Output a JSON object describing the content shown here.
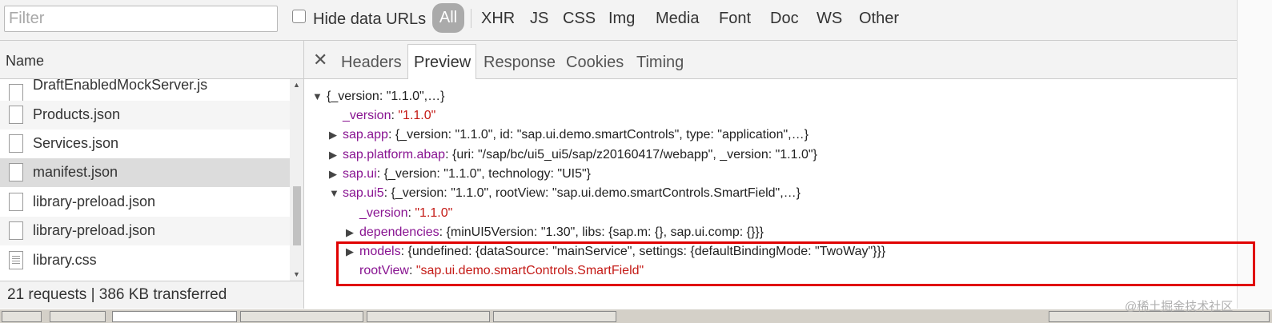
{
  "toolbar": {
    "filter_placeholder": "Filter",
    "hide_data_urls_label": "Hide data URLs",
    "hide_data_urls_checked": false,
    "types": [
      "All",
      "XHR",
      "JS",
      "CSS",
      "Img",
      "Media",
      "Font",
      "Doc",
      "WS",
      "Other"
    ],
    "active_type": "All"
  },
  "requests_panel": {
    "header": "Name",
    "files": [
      {
        "name": "DraftEnabledMockServer.js",
        "icon": "document-icon"
      },
      {
        "name": "Products.json",
        "icon": "document-icon"
      },
      {
        "name": "Services.json",
        "icon": "document-icon"
      },
      {
        "name": "manifest.json",
        "icon": "document-icon",
        "selected": true
      },
      {
        "name": "library-preload.json",
        "icon": "document-icon"
      },
      {
        "name": "library-preload.json",
        "icon": "document-icon"
      },
      {
        "name": "library.css",
        "icon": "stylesheet-icon"
      }
    ],
    "status": "21 requests  |  386 KB transferred"
  },
  "detail_panel": {
    "tabs": [
      "Headers",
      "Preview",
      "Response",
      "Cookies",
      "Timing"
    ],
    "active_tab": "Preview",
    "preview_lines": [
      {
        "text": "{_version: \"1.1.0\",…}"
      },
      {
        "key": "_version",
        "value": "\"1.1.0\""
      },
      {
        "key": "sap.app",
        "text": "{_version: \"1.1.0\", id: \"sap.ui.demo.smartControls\", type: \"application\",…}"
      },
      {
        "key": "sap.platform.abap",
        "text": "{uri: \"/sap/bc/ui5_ui5/sap/z20160417/webapp\", _version: \"1.1.0\"}"
      },
      {
        "key": "sap.ui",
        "text": "{_version: \"1.1.0\", technology: \"UI5\"}"
      },
      {
        "key": "sap.ui5",
        "text": "{_version: \"1.1.0\", rootView: \"sap.ui.demo.smartControls.SmartField\",…}"
      },
      {
        "key": "_version",
        "value": "\"1.1.0\""
      },
      {
        "key": "dependencies",
        "text": "{minUI5Version: \"1.30\", libs: {sap.m: {}, sap.ui.comp: {}}}"
      },
      {
        "key": "models",
        "text": "{undefined: {dataSource: \"mainService\", settings: {defaultBindingMode: \"TwoWay\"}}}"
      },
      {
        "key": "rootView",
        "value": "\"sap.ui.demo.smartControls.SmartField\""
      }
    ],
    "highlight_color": "#e00000"
  },
  "watermark": "@稀土掘金技术社区",
  "colors": {
    "key": "#881391",
    "string": "#c41a16",
    "active_filter_bg": "#aaaaaa"
  }
}
